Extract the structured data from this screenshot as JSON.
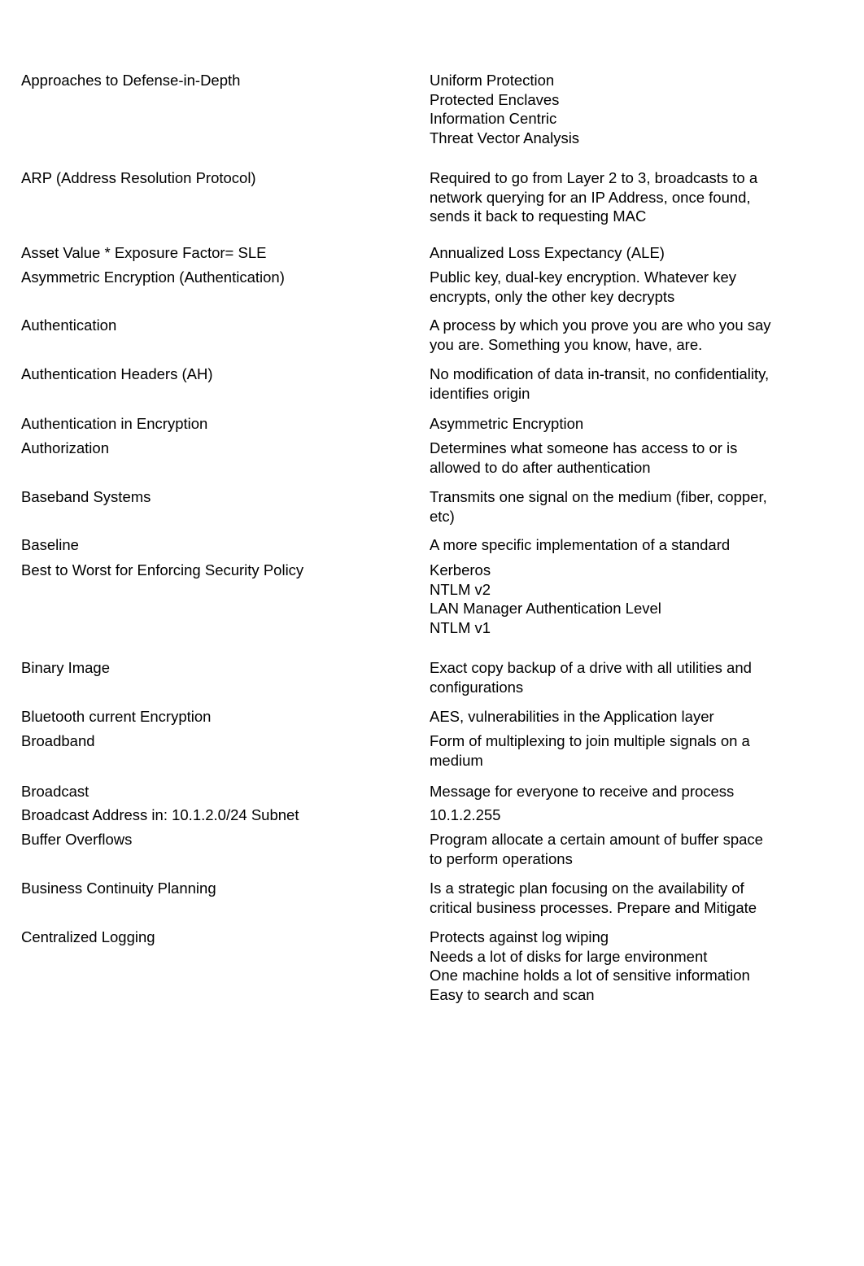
{
  "rows": [
    {
      "term": "Approaches to Defense-in-Depth",
      "definition": "Uniform Protection\nProtected Enclaves\nInformation Centric\nThreat Vector Analysis"
    },
    {
      "term": "ARP (Address Resolution Protocol)",
      "definition": "Required to go from Layer 2 to 3, broadcasts to a\nnetwork querying for an IP Address, once found,\nsends it back to requesting MAC"
    },
    {
      "term": "Asset Value * Exposure Factor= SLE",
      "definition": "Annualized Loss Expectancy (ALE)"
    },
    {
      "term": "Asymmetric Encryption (Authentication)",
      "definition": "Public key, dual-key encryption. Whatever key\nencrypts, only the other key decrypts"
    },
    {
      "term": "Authentication",
      "definition": "A process by which you prove you are who you say\nyou are. Something you know, have, are."
    },
    {
      "term": "Authentication Headers (AH)",
      "definition": "No modification of data in-transit, no confidentiality,\nidentifies origin"
    },
    {
      "term": "Authentication in Encryption",
      "definition": "Asymmetric Encryption"
    },
    {
      "term": "Authorization",
      "definition": "Determines what someone has access to or is\nallowed to do after authentication"
    },
    {
      "term": "Baseband Systems",
      "definition": "Transmits one signal on the medium (fiber, copper,\netc)"
    },
    {
      "term": "Baseline",
      "definition": "A more specific implementation of a standard"
    },
    {
      "term": "Best to Worst for Enforcing Security Policy",
      "definition": "Kerberos\nNTLM v2\nLAN Manager Authentication Level\nNTLM v1"
    },
    {
      "term": "Binary Image",
      "definition": "Exact copy backup of a drive with all utilities and\nconfigurations"
    },
    {
      "term": "Bluetooth current Encryption",
      "definition": "AES, vulnerabilities in the Application layer"
    },
    {
      "term": "Broadband",
      "definition": "Form of multiplexing to join multiple signals on a\nmedium"
    },
    {
      "term": "Broadcast",
      "definition": "Message for everyone to receive and process"
    },
    {
      "term": "Broadcast Address in: 10.1.2.0/24 Subnet",
      "definition": "10.1.2.255"
    },
    {
      "term": "Buffer Overflows",
      "definition": "Program allocate a certain amount of buffer space\nto perform operations"
    },
    {
      "term": "Business Continuity Planning",
      "definition": "Is a strategic plan focusing on the availability of\ncritical business processes. Prepare and Mitigate"
    },
    {
      "term": "Centralized Logging",
      "definition": "Protects against log wiping\nNeeds a lot of disks for large environment\nOne machine holds a lot of sensitive information\nEasy to search and scan"
    }
  ]
}
